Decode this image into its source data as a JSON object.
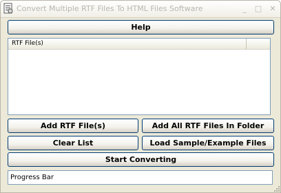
{
  "window": {
    "title": "Convert Multiple RTF Files To HTML Files Software",
    "icon": "app-icon",
    "controls": {
      "minimize": "_",
      "maximize": "□",
      "close": "✕"
    }
  },
  "toolbar": {
    "help_label": "Help"
  },
  "file_list": {
    "column_header": "RTF File(s)",
    "rows": []
  },
  "actions": {
    "add_files_label": "Add RTF File(s)",
    "add_folder_label": "Add All RTF Files In Folder",
    "clear_list_label": "Clear List",
    "load_sample_label": "Load Sample/Example Files",
    "start_label": "Start Converting"
  },
  "status": {
    "progress_text": "Progress Bar"
  },
  "colors": {
    "window_bg": "#ece9d8",
    "button_border": "#003c74",
    "field_border": "#7f9db9",
    "title_text": "#b9b6ae"
  }
}
